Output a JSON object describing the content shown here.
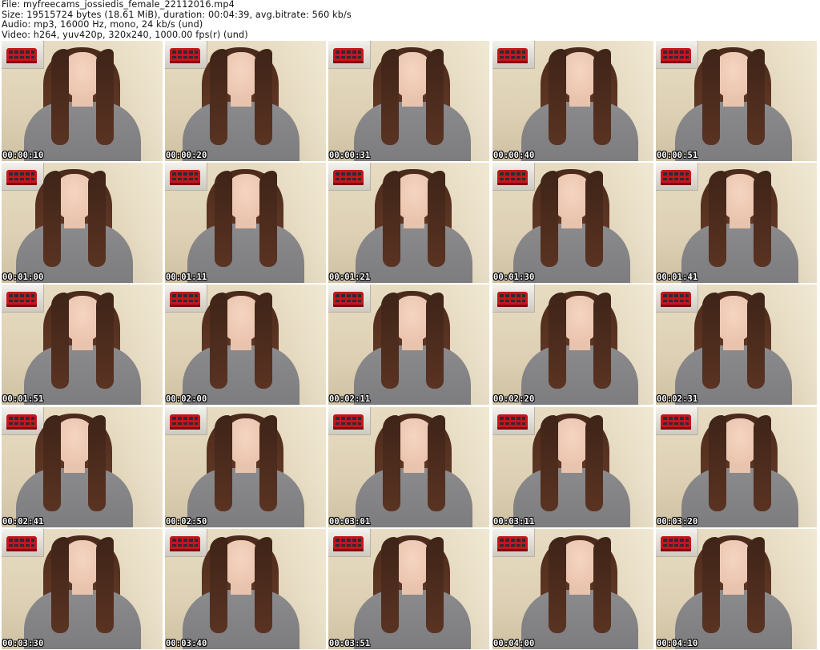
{
  "header": {
    "file": "File: myfreecams_jossiedis_female_22112016.mp4",
    "size": "Size: 19515724 bytes (18.61 MiB), duration: 00:04:39, avg.bitrate: 560 kb/s",
    "audio": "Audio: mp3, 16000 Hz, mono, 24 kb/s (und)",
    "video": "Video: h264, yuv420p, 320x240, 1000.00 fps(r) (und)"
  },
  "thumbnails": [
    {
      "timestamp": "00:00:10"
    },
    {
      "timestamp": "00:00:20"
    },
    {
      "timestamp": "00:00:31"
    },
    {
      "timestamp": "00:00:40"
    },
    {
      "timestamp": "00:00:51"
    },
    {
      "timestamp": "00:01:00"
    },
    {
      "timestamp": "00:01:11"
    },
    {
      "timestamp": "00:01:21"
    },
    {
      "timestamp": "00:01:30"
    },
    {
      "timestamp": "00:01:41"
    },
    {
      "timestamp": "00:01:51"
    },
    {
      "timestamp": "00:02:00"
    },
    {
      "timestamp": "00:02:11"
    },
    {
      "timestamp": "00:02:20"
    },
    {
      "timestamp": "00:02:31"
    },
    {
      "timestamp": "00:02:41"
    },
    {
      "timestamp": "00:02:50"
    },
    {
      "timestamp": "00:03:01"
    },
    {
      "timestamp": "00:03:11"
    },
    {
      "timestamp": "00:03:20"
    },
    {
      "timestamp": "00:03:30"
    },
    {
      "timestamp": "00:03:40"
    },
    {
      "timestamp": "00:03:51"
    },
    {
      "timestamp": "00:04:00"
    },
    {
      "timestamp": "00:04:10"
    }
  ],
  "colors": {
    "background": "#ffffff",
    "header_text": "#111111",
    "timestamp_text": "#ffffff",
    "wall": "#e7dcc2",
    "shirt": "#8b8a8c",
    "hair": "#5f3624",
    "bus": "#c5161b"
  }
}
